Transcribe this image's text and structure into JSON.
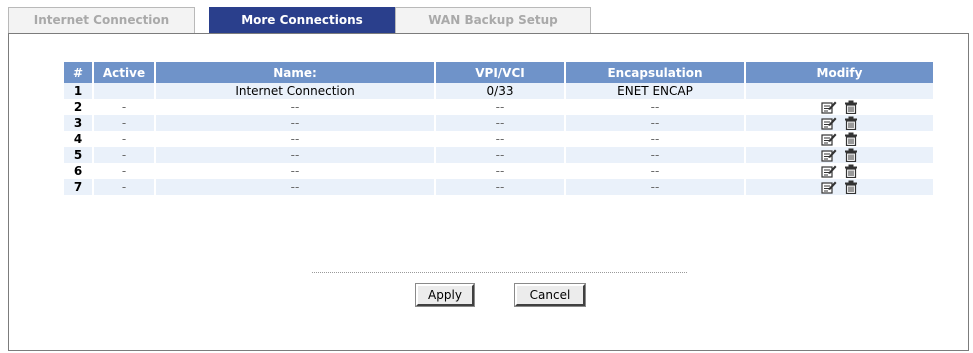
{
  "tabs": [
    {
      "label": "Internet Connection",
      "active": false
    },
    {
      "label": "More Connections",
      "active": true
    },
    {
      "label": "WAN Backup Setup",
      "active": false
    }
  ],
  "table": {
    "headers": [
      "#",
      "Active",
      "Name:",
      "VPI/VCI",
      "Encapsulation",
      "Modify"
    ],
    "rows": [
      {
        "num": "1",
        "active": "",
        "name": "Internet Connection",
        "vpivci": "0/33",
        "encap": "ENET ENCAP",
        "modify": false
      },
      {
        "num": "2",
        "active": "-",
        "name": "--",
        "vpivci": "--",
        "encap": "--",
        "modify": true
      },
      {
        "num": "3",
        "active": "-",
        "name": "--",
        "vpivci": "--",
        "encap": "--",
        "modify": true
      },
      {
        "num": "4",
        "active": "-",
        "name": "--",
        "vpivci": "--",
        "encap": "--",
        "modify": true
      },
      {
        "num": "5",
        "active": "-",
        "name": "--",
        "vpivci": "--",
        "encap": "--",
        "modify": true
      },
      {
        "num": "6",
        "active": "-",
        "name": "--",
        "vpivci": "--",
        "encap": "--",
        "modify": true
      },
      {
        "num": "7",
        "active": "-",
        "name": "--",
        "vpivci": "--",
        "encap": "--",
        "modify": true
      }
    ],
    "icons": {
      "edit": "edit-icon",
      "delete": "trash-icon"
    }
  },
  "buttons": {
    "apply": "Apply",
    "cancel": "Cancel"
  },
  "colors": {
    "tab_active": "#2a3f8c",
    "header": "#6f93c9",
    "row_alt": "#eaf1fa"
  }
}
